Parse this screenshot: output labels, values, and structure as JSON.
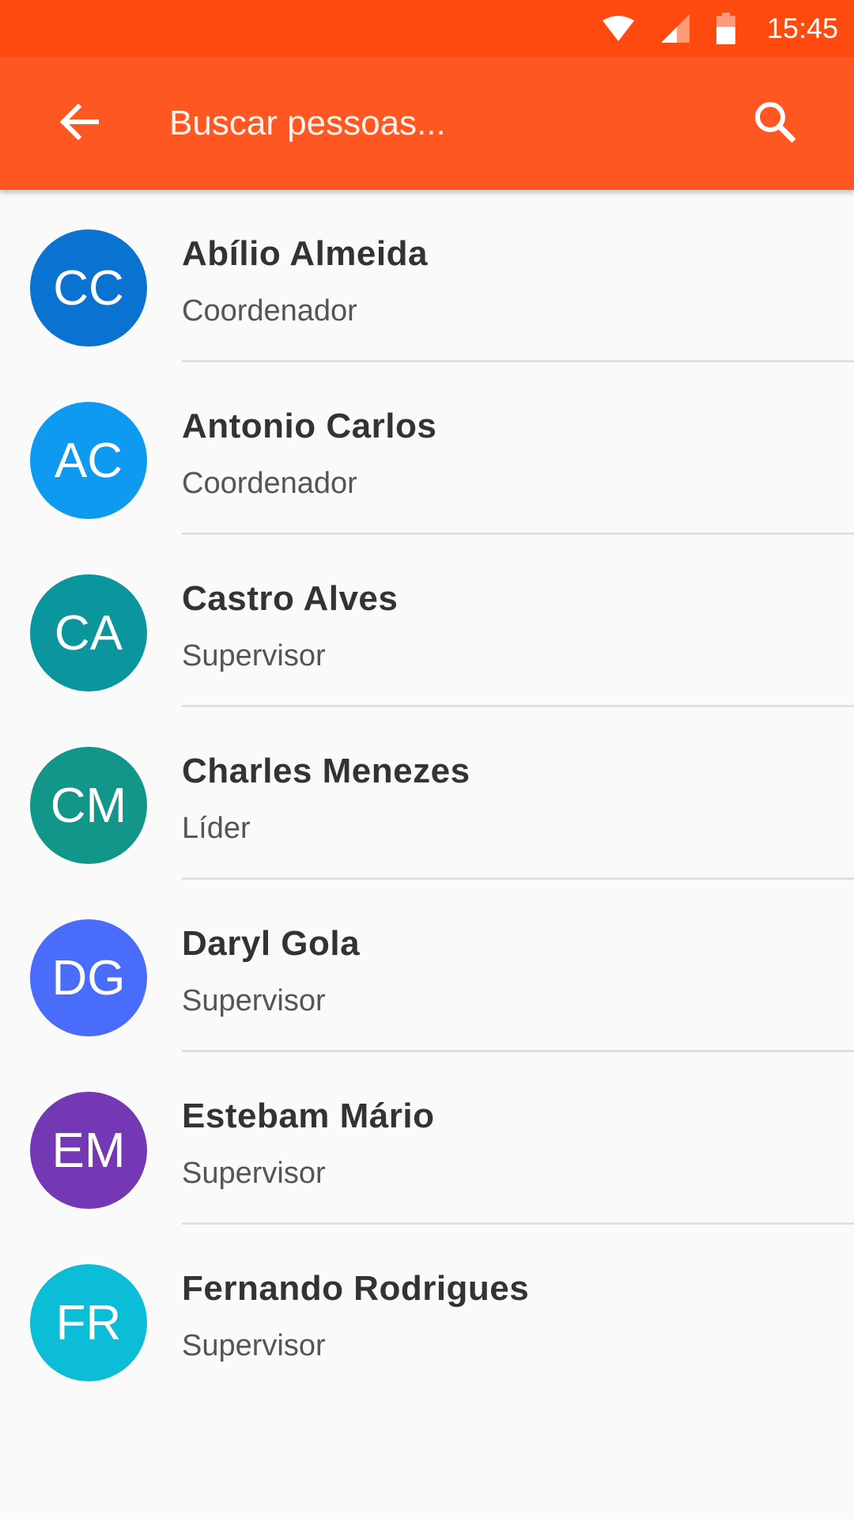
{
  "status_bar": {
    "time": "15:45",
    "icons": [
      "wifi-icon",
      "cell-signal-icon",
      "battery-icon"
    ]
  },
  "app_bar": {
    "back_icon": "arrow-back-icon",
    "search_placeholder": "Buscar pessoas...",
    "search_value": "",
    "search_icon": "search-icon"
  },
  "colors": {
    "status_bar": "#ff4a0f",
    "app_bar": "#ff5722"
  },
  "people": [
    {
      "initials": "CC",
      "name": "Abílio Almeida",
      "role": "Coordenador",
      "color": "#0a73d1"
    },
    {
      "initials": "AC",
      "name": "Antonio Carlos",
      "role": "Coordenador",
      "color": "#0d9af0"
    },
    {
      "initials": "CA",
      "name": "Castro Alves",
      "role": "Supervisor",
      "color": "#0b969e"
    },
    {
      "initials": "CM",
      "name": "Charles Menezes",
      "role": "Líder",
      "color": "#12968a"
    },
    {
      "initials": "DG",
      "name": "Daryl Gola",
      "role": "Supervisor",
      "color": "#4a6cfa"
    },
    {
      "initials": "EM",
      "name": "Estebam Mário",
      "role": "Supervisor",
      "color": "#7438b5"
    },
    {
      "initials": "FR",
      "name": "Fernando Rodrigues",
      "role": "Supervisor",
      "color": "#0bbdd6"
    }
  ]
}
